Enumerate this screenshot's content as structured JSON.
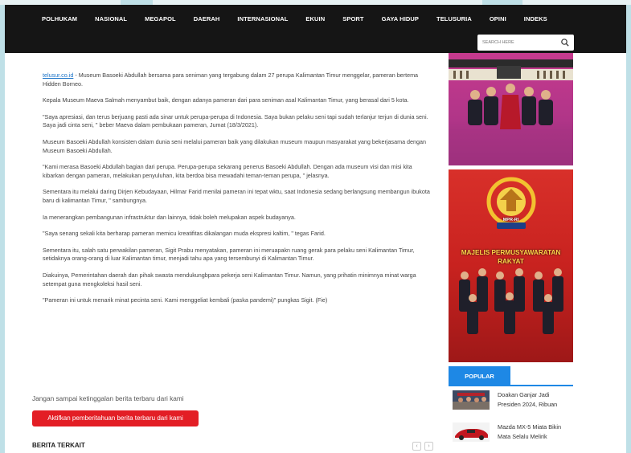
{
  "nav": [
    "POLHUKAM",
    "NASIONAL",
    "MEGAPOL",
    "DAERAH",
    "INTERNASIONAL",
    "EKUIN",
    "SPORT",
    "GAYA HIDUP",
    "TELUSURIA",
    "OPINI",
    "INDEKS"
  ],
  "search": {
    "placeholder": "SEARCH HERE"
  },
  "article": {
    "source_link": "telusur.co.id",
    "p1_rest": " - Museum Basoeki Abdullah bersama para seniman yang tergabung dalam 27 perupa Kalimantan Timur menggelar, pameran bertema Hidden Borneo.",
    "paragraphs": [
      "Kepala Museum Maeva Salmah menyambut baik, dengan adanya pameran dari para seniman asal Kalimantan Timur, yang berasal dari 5 kota.",
      "\"Saya apresiasi,  dan terus berjuang pasti ada sinar untuk perupa-perupa di Indonesia.  Saya bukan pelaku seni tapi sudah terlanjur terjun di dunia seni. Saya jadi cinta seni, \" beber Maeva dalam pembukaan pameran,  Jumat (18/3/2021).",
      "Museum Basoeki Abdullah konsisten dalam dunia seni melalui pameran baik yang dilakukan museum maupun masyarakat yang bekerjasama dengan Museum Basoeki Abdullah.",
      "\"Kami merasa Basoeki Abdullah bagian dari perupa. Perupa-perupa sekarang penerus Basoeki Abdullah. Dengan ada museum visi dan misi kita kibarkan dengan pameran,  melakukan penyuluhan, kita berdoa bisa mewadahi teman-teman perupa, \" jelasnya.",
      "Sementara itu melalui daring Dirjen Kebudayaan,  Hilmar Farid menilai pameran ini tepat wktu,  saat Indonesia sedang berlangsung membangun ibukota baru di kalimantan Timur, \" sambungnya.",
      "Ia menerangkan pembangunan infrastruktur dan lainnya,  tidak boleh melupakan aspek budayanya.",
      "\"Saya senang sekali  kita berharap pameran memicu kreatifitas dikalangan muda ekspresi kaltim, \" tegas Farid.",
      "Sementara itu,  salah satu perwakilan pameran,  Sigit Prabu menyatakan,  pameran ini meruapakn ruang gerak para pelaku seni Kalimantan Timur,  setidaknya orang-orang di luar Kalimantan timur, menjadi tahu apa yang tersembunyi di Kalimantan Timur.",
      "Diakuinya,  Pemerintahan daerah dan pihak swasta mendukungbpara pekerja seni Kalimantan Timur.  Namun,  yang prihatin minimnya minat warga setempat guna mengkoleksi hasil seni.",
      "\"Pameran ini untuk menarik minat pecinta seni.  Kami menggeliat kembali (paska pandemi)\" pungkas Sigit. (Fie)"
    ]
  },
  "notify": {
    "text": "Jangan sampai ketinggalan berita terbaru dari kami",
    "button": "Aktifkan pemberitahuan berita terbaru dari kami"
  },
  "related": {
    "title": "BERITA TERKAIT",
    "prev": "‹",
    "next": "›"
  },
  "ads": {
    "mpr_title": "MAJELIS PERMUSYAWARATAN RAKYAT",
    "mpr_badge": "MPR-RI"
  },
  "popular": {
    "tab": "POPULAR",
    "items": [
      {
        "title": "Doakan Ganjar Jadi Presiden 2024, Ribuan"
      },
      {
        "title": "Mazda MX-5 Miata Bikin Mata Selalu Melirik"
      }
    ]
  },
  "colors": {
    "header": "#151515",
    "accent": "#1e88e5",
    "button": "#e31e25",
    "link": "#1a73c8"
  }
}
